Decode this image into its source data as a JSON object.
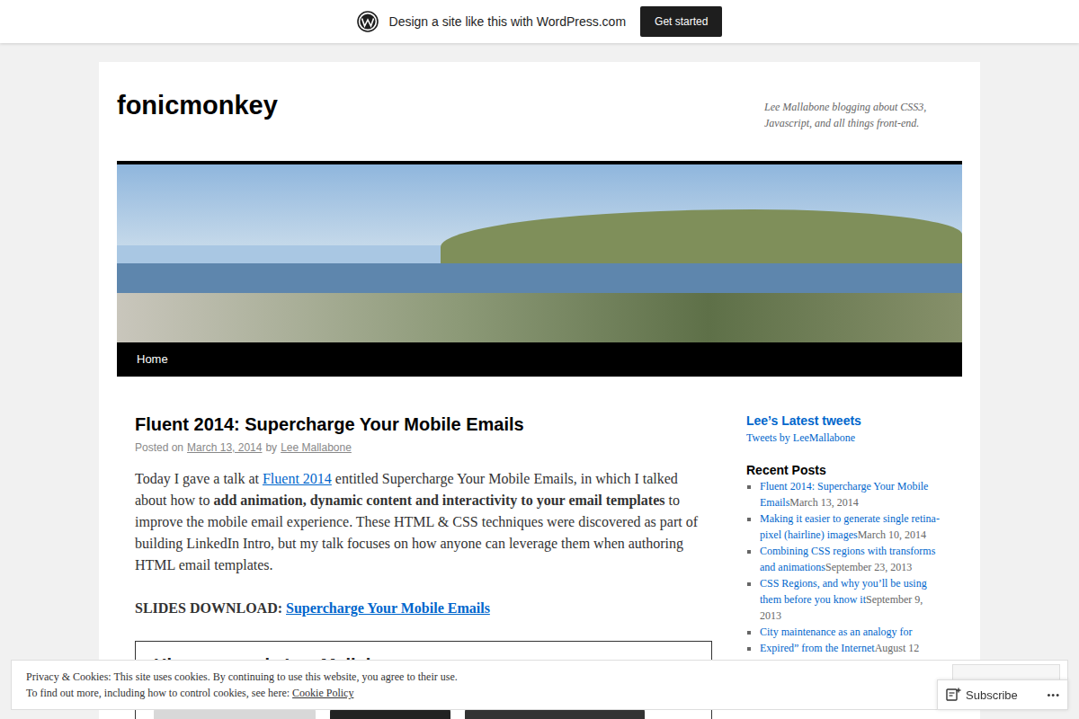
{
  "wpcom_bar": {
    "text": "Design a site like this with WordPress.com",
    "button": "Get started"
  },
  "site": {
    "title": "fonicmonkey",
    "description": "Lee Mallabone blogging about CSS3, Javascript, and all things front-end."
  },
  "nav": [
    "Home"
  ],
  "post": {
    "title": "Fluent 2014: Supercharge Your Mobile Emails",
    "meta": {
      "prefix": "Posted on",
      "date": "March 13, 2014",
      "by": "by",
      "author": "Lee Mallabone"
    },
    "intro": [
      {
        "kind": "text",
        "text": "Today I gave a talk at "
      },
      {
        "kind": "link",
        "text": "Fluent 2014"
      },
      {
        "kind": "text",
        "text": " entitled Supercharge Your Mobile Emails, in which I talked about how to "
      },
      {
        "kind": "bold",
        "text": "add animation, dynamic content and interactivity to your email templates"
      },
      {
        "kind": "text",
        "text": " to improve the mobile email experience. These HTML & CSS techniques were discovered as part of building LinkedIn Intro, but my talk focuses on how anyone can leverage them when authoring HTML email templates."
      }
    ],
    "slides": {
      "label": "SLIDES DOWNLOAD:",
      "link": "Supercharge Your Mobile Emails"
    },
    "slide_image": {
      "heading": "Hi, my name is Lee Mallabone"
    }
  },
  "sidebar": {
    "tweets": {
      "title": "Lee’s Latest tweets",
      "link": "Tweets by LeeMallabone"
    },
    "recent_posts": {
      "title": "Recent Posts",
      "items": [
        {
          "title": "Fluent 2014: Supercharge Your Mobile Emails",
          "date": "March 13, 2014"
        },
        {
          "title": "Making it easier to generate single retina-pixel (hairline) images",
          "date": "March 10, 2014"
        },
        {
          "title": "Combining CSS regions with transforms and animations",
          "date": "September 23, 2013"
        },
        {
          "title": "CSS Regions, and why you’ll be using them before you know it",
          "date": "September 9, 2013"
        },
        {
          "title": "City maintenance as an analogy for",
          "date": ""
        },
        {
          "title": "Expired” from the Internet",
          "date": "August 12"
        }
      ]
    }
  },
  "cookie_banner": {
    "line1": "Privacy & Cookies: This site uses cookies. By continuing to use this website, you agree to their use.",
    "line2": "To find out more, including how to control cookies, see here:",
    "link": "Cookie Policy"
  },
  "subscribe": {
    "label": "Subscribe",
    "more": "•••"
  }
}
